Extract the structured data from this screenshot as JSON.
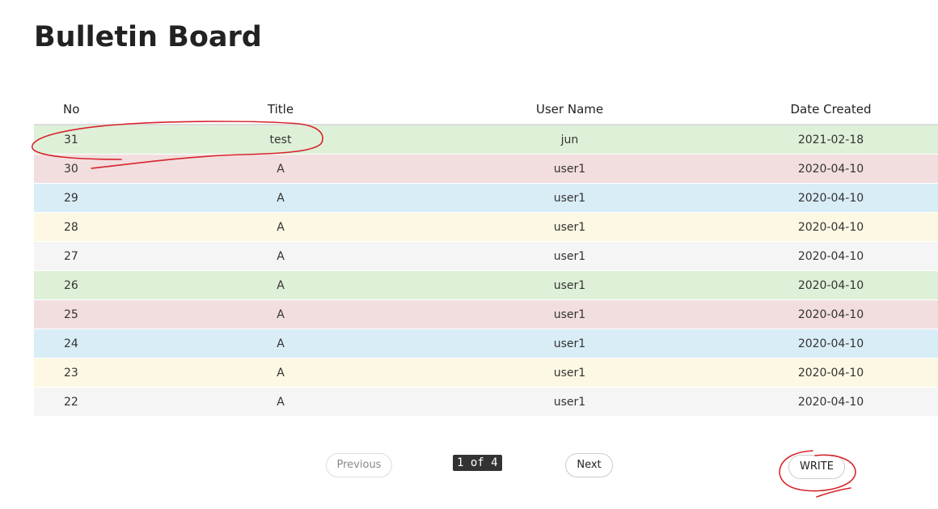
{
  "page": {
    "title": "Bulletin Board"
  },
  "table": {
    "headers": {
      "no": "No",
      "title": "Title",
      "user_name": "User Name",
      "date_created": "Date Created"
    },
    "rows": [
      {
        "no": "31",
        "title": "test",
        "user": "jun",
        "date": "2021-02-18",
        "style": "green"
      },
      {
        "no": "30",
        "title": "A",
        "user": "user1",
        "date": "2020-04-10",
        "style": "red"
      },
      {
        "no": "29",
        "title": "A",
        "user": "user1",
        "date": "2020-04-10",
        "style": "blue"
      },
      {
        "no": "28",
        "title": "A",
        "user": "user1",
        "date": "2020-04-10",
        "style": "yellow"
      },
      {
        "no": "27",
        "title": "A",
        "user": "user1",
        "date": "2020-04-10",
        "style": "gray"
      },
      {
        "no": "26",
        "title": "A",
        "user": "user1",
        "date": "2020-04-10",
        "style": "green"
      },
      {
        "no": "25",
        "title": "A",
        "user": "user1",
        "date": "2020-04-10",
        "style": "red"
      },
      {
        "no": "24",
        "title": "A",
        "user": "user1",
        "date": "2020-04-10",
        "style": "blue"
      },
      {
        "no": "23",
        "title": "A",
        "user": "user1",
        "date": "2020-04-10",
        "style": "yellow"
      },
      {
        "no": "22",
        "title": "A",
        "user": "user1",
        "date": "2020-04-10",
        "style": "gray"
      }
    ]
  },
  "pagination": {
    "previous_label": "Previous",
    "indicator": "1 of 4",
    "next_label": "Next"
  },
  "actions": {
    "write_label": "WRITE"
  },
  "colors": {
    "annotation": "#d6242b",
    "row_green": "#dff0d8",
    "row_red": "#f2dede",
    "row_blue": "#d9edf7",
    "row_yellow": "#fcf8e3",
    "row_gray": "#f5f5f5"
  }
}
